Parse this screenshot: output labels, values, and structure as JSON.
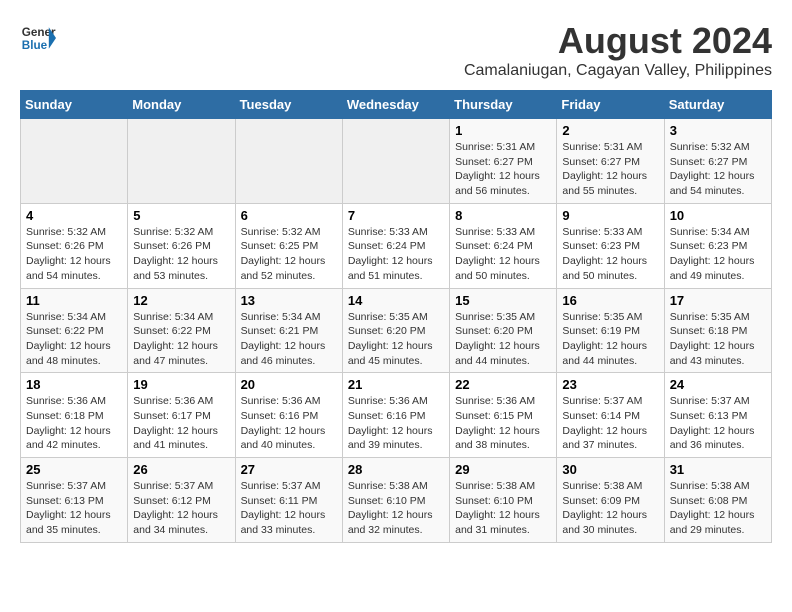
{
  "header": {
    "logo_line1": "General",
    "logo_line2": "Blue",
    "main_title": "August 2024",
    "subtitle": "Camalaniugan, Cagayan Valley, Philippines"
  },
  "calendar": {
    "headers": [
      "Sunday",
      "Monday",
      "Tuesday",
      "Wednesday",
      "Thursday",
      "Friday",
      "Saturday"
    ],
    "weeks": [
      [
        {
          "day": "",
          "info": ""
        },
        {
          "day": "",
          "info": ""
        },
        {
          "day": "",
          "info": ""
        },
        {
          "day": "",
          "info": ""
        },
        {
          "day": "1",
          "info": "Sunrise: 5:31 AM\nSunset: 6:27 PM\nDaylight: 12 hours\nand 56 minutes."
        },
        {
          "day": "2",
          "info": "Sunrise: 5:31 AM\nSunset: 6:27 PM\nDaylight: 12 hours\nand 55 minutes."
        },
        {
          "day": "3",
          "info": "Sunrise: 5:32 AM\nSunset: 6:27 PM\nDaylight: 12 hours\nand 54 minutes."
        }
      ],
      [
        {
          "day": "4",
          "info": "Sunrise: 5:32 AM\nSunset: 6:26 PM\nDaylight: 12 hours\nand 54 minutes."
        },
        {
          "day": "5",
          "info": "Sunrise: 5:32 AM\nSunset: 6:26 PM\nDaylight: 12 hours\nand 53 minutes."
        },
        {
          "day": "6",
          "info": "Sunrise: 5:32 AM\nSunset: 6:25 PM\nDaylight: 12 hours\nand 52 minutes."
        },
        {
          "day": "7",
          "info": "Sunrise: 5:33 AM\nSunset: 6:24 PM\nDaylight: 12 hours\nand 51 minutes."
        },
        {
          "day": "8",
          "info": "Sunrise: 5:33 AM\nSunset: 6:24 PM\nDaylight: 12 hours\nand 50 minutes."
        },
        {
          "day": "9",
          "info": "Sunrise: 5:33 AM\nSunset: 6:23 PM\nDaylight: 12 hours\nand 50 minutes."
        },
        {
          "day": "10",
          "info": "Sunrise: 5:34 AM\nSunset: 6:23 PM\nDaylight: 12 hours\nand 49 minutes."
        }
      ],
      [
        {
          "day": "11",
          "info": "Sunrise: 5:34 AM\nSunset: 6:22 PM\nDaylight: 12 hours\nand 48 minutes."
        },
        {
          "day": "12",
          "info": "Sunrise: 5:34 AM\nSunset: 6:22 PM\nDaylight: 12 hours\nand 47 minutes."
        },
        {
          "day": "13",
          "info": "Sunrise: 5:34 AM\nSunset: 6:21 PM\nDaylight: 12 hours\nand 46 minutes."
        },
        {
          "day": "14",
          "info": "Sunrise: 5:35 AM\nSunset: 6:20 PM\nDaylight: 12 hours\nand 45 minutes."
        },
        {
          "day": "15",
          "info": "Sunrise: 5:35 AM\nSunset: 6:20 PM\nDaylight: 12 hours\nand 44 minutes."
        },
        {
          "day": "16",
          "info": "Sunrise: 5:35 AM\nSunset: 6:19 PM\nDaylight: 12 hours\nand 44 minutes."
        },
        {
          "day": "17",
          "info": "Sunrise: 5:35 AM\nSunset: 6:18 PM\nDaylight: 12 hours\nand 43 minutes."
        }
      ],
      [
        {
          "day": "18",
          "info": "Sunrise: 5:36 AM\nSunset: 6:18 PM\nDaylight: 12 hours\nand 42 minutes."
        },
        {
          "day": "19",
          "info": "Sunrise: 5:36 AM\nSunset: 6:17 PM\nDaylight: 12 hours\nand 41 minutes."
        },
        {
          "day": "20",
          "info": "Sunrise: 5:36 AM\nSunset: 6:16 PM\nDaylight: 12 hours\nand 40 minutes."
        },
        {
          "day": "21",
          "info": "Sunrise: 5:36 AM\nSunset: 6:16 PM\nDaylight: 12 hours\nand 39 minutes."
        },
        {
          "day": "22",
          "info": "Sunrise: 5:36 AM\nSunset: 6:15 PM\nDaylight: 12 hours\nand 38 minutes."
        },
        {
          "day": "23",
          "info": "Sunrise: 5:37 AM\nSunset: 6:14 PM\nDaylight: 12 hours\nand 37 minutes."
        },
        {
          "day": "24",
          "info": "Sunrise: 5:37 AM\nSunset: 6:13 PM\nDaylight: 12 hours\nand 36 minutes."
        }
      ],
      [
        {
          "day": "25",
          "info": "Sunrise: 5:37 AM\nSunset: 6:13 PM\nDaylight: 12 hours\nand 35 minutes."
        },
        {
          "day": "26",
          "info": "Sunrise: 5:37 AM\nSunset: 6:12 PM\nDaylight: 12 hours\nand 34 minutes."
        },
        {
          "day": "27",
          "info": "Sunrise: 5:37 AM\nSunset: 6:11 PM\nDaylight: 12 hours\nand 33 minutes."
        },
        {
          "day": "28",
          "info": "Sunrise: 5:38 AM\nSunset: 6:10 PM\nDaylight: 12 hours\nand 32 minutes."
        },
        {
          "day": "29",
          "info": "Sunrise: 5:38 AM\nSunset: 6:10 PM\nDaylight: 12 hours\nand 31 minutes."
        },
        {
          "day": "30",
          "info": "Sunrise: 5:38 AM\nSunset: 6:09 PM\nDaylight: 12 hours\nand 30 minutes."
        },
        {
          "day": "31",
          "info": "Sunrise: 5:38 AM\nSunset: 6:08 PM\nDaylight: 12 hours\nand 29 minutes."
        }
      ]
    ]
  }
}
